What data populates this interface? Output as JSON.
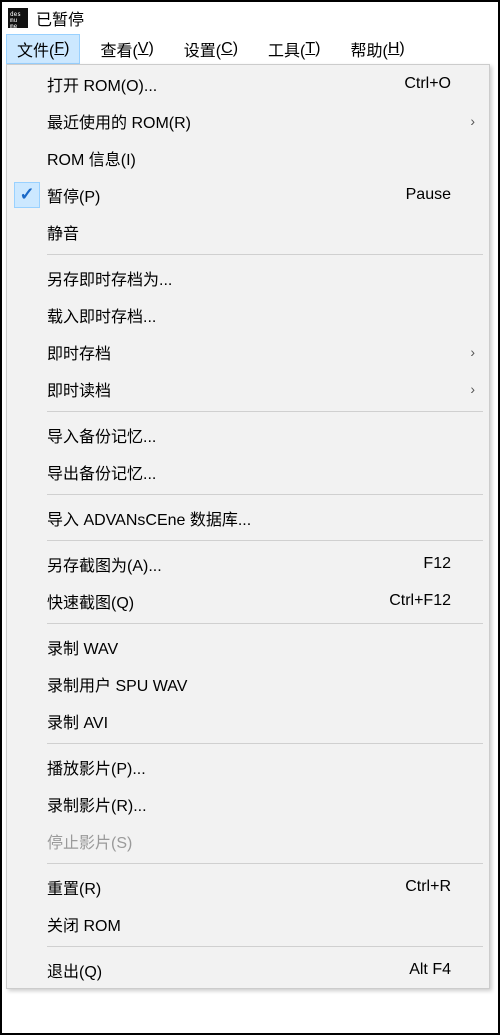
{
  "window": {
    "title": "已暂停",
    "icon_name": "desmume-icon"
  },
  "menubar": {
    "items": [
      {
        "label": "文件(F)",
        "active": true
      },
      {
        "label": "查看(V)",
        "active": false
      },
      {
        "label": "设置(C)",
        "active": false
      },
      {
        "label": "工具(T)",
        "active": false
      },
      {
        "label": "帮助(H)",
        "active": false
      }
    ]
  },
  "menu": [
    {
      "type": "item",
      "label": "打开 ROM(O)...",
      "accel": "Ctrl+O",
      "checked": false,
      "submenu": false,
      "disabled": false
    },
    {
      "type": "item",
      "label": "最近使用的 ROM(R)",
      "accel": "",
      "checked": false,
      "submenu": true,
      "disabled": false
    },
    {
      "type": "item",
      "label": "ROM 信息(I)",
      "accel": "",
      "checked": false,
      "submenu": false,
      "disabled": false
    },
    {
      "type": "item",
      "label": "暂停(P)",
      "accel": "Pause",
      "checked": true,
      "submenu": false,
      "disabled": false
    },
    {
      "type": "item",
      "label": "静音",
      "accel": "",
      "checked": false,
      "submenu": false,
      "disabled": false
    },
    {
      "type": "separator"
    },
    {
      "type": "item",
      "label": "另存即时存档为...",
      "accel": "",
      "checked": false,
      "submenu": false,
      "disabled": false
    },
    {
      "type": "item",
      "label": "载入即时存档...",
      "accel": "",
      "checked": false,
      "submenu": false,
      "disabled": false
    },
    {
      "type": "item",
      "label": "即时存档",
      "accel": "",
      "checked": false,
      "submenu": true,
      "disabled": false
    },
    {
      "type": "item",
      "label": "即时读档",
      "accel": "",
      "checked": false,
      "submenu": true,
      "disabled": false
    },
    {
      "type": "separator"
    },
    {
      "type": "item",
      "label": "导入备份记忆...",
      "accel": "",
      "checked": false,
      "submenu": false,
      "disabled": false
    },
    {
      "type": "item",
      "label": "导出备份记忆...",
      "accel": "",
      "checked": false,
      "submenu": false,
      "disabled": false
    },
    {
      "type": "separator"
    },
    {
      "type": "item",
      "label": "导入 ADVANsCEne 数据库...",
      "accel": "",
      "checked": false,
      "submenu": false,
      "disabled": false
    },
    {
      "type": "separator"
    },
    {
      "type": "item",
      "label": "另存截图为(A)...",
      "accel": "F12",
      "checked": false,
      "submenu": false,
      "disabled": false
    },
    {
      "type": "item",
      "label": "快速截图(Q)",
      "accel": "Ctrl+F12",
      "checked": false,
      "submenu": false,
      "disabled": false
    },
    {
      "type": "separator"
    },
    {
      "type": "item",
      "label": "录制 WAV",
      "accel": "",
      "checked": false,
      "submenu": false,
      "disabled": false
    },
    {
      "type": "item",
      "label": "录制用户 SPU WAV",
      "accel": "",
      "checked": false,
      "submenu": false,
      "disabled": false
    },
    {
      "type": "item",
      "label": "录制 AVI",
      "accel": "",
      "checked": false,
      "submenu": false,
      "disabled": false
    },
    {
      "type": "separator"
    },
    {
      "type": "item",
      "label": "播放影片(P)...",
      "accel": "",
      "checked": false,
      "submenu": false,
      "disabled": false
    },
    {
      "type": "item",
      "label": "录制影片(R)...",
      "accel": "",
      "checked": false,
      "submenu": false,
      "disabled": false
    },
    {
      "type": "item",
      "label": "停止影片(S)",
      "accel": "",
      "checked": false,
      "submenu": false,
      "disabled": true
    },
    {
      "type": "separator"
    },
    {
      "type": "item",
      "label": "重置(R)",
      "accel": "Ctrl+R",
      "checked": false,
      "submenu": false,
      "disabled": false
    },
    {
      "type": "item",
      "label": "关闭 ROM",
      "accel": "",
      "checked": false,
      "submenu": false,
      "disabled": false
    },
    {
      "type": "separator"
    },
    {
      "type": "item",
      "label": "退出(Q)",
      "accel": "Alt F4",
      "checked": false,
      "submenu": false,
      "disabled": false
    }
  ]
}
